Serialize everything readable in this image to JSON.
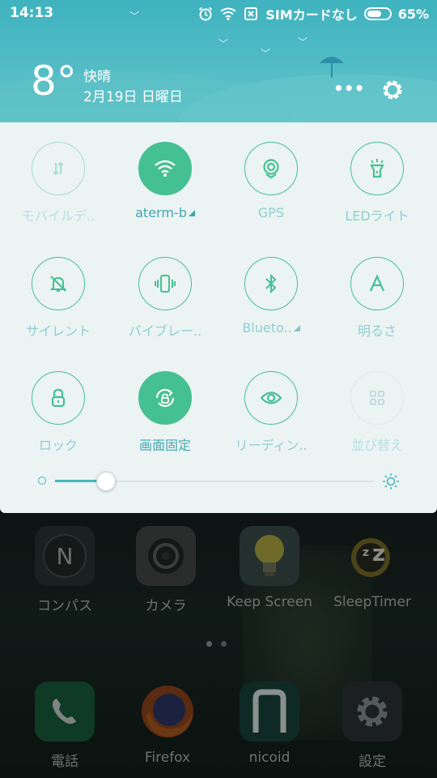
{
  "status_bar": {
    "time": "14:13",
    "carrier": "SIMカードなし",
    "battery_percent": "65%",
    "battery_level": 0.65,
    "icons": [
      "alarm-icon",
      "wifi-icon",
      "no-sim-icon",
      "battery-icon"
    ]
  },
  "weather": {
    "temperature": "8°",
    "condition": "快晴",
    "date": "2月19日 日曜日"
  },
  "header_actions": {
    "more": "•••",
    "settings_icon": "gear-icon"
  },
  "quick_tiles": [
    {
      "label": "モバイルデ..",
      "icon": "mobile-data-icon",
      "state": "off-disabled"
    },
    {
      "label": "aterm-b",
      "icon": "wifi-icon",
      "state": "on",
      "has_menu": true
    },
    {
      "label": "GPS",
      "icon": "gps-icon",
      "state": "off"
    },
    {
      "label": "LEDライト",
      "icon": "flashlight-icon",
      "state": "off"
    },
    {
      "label": "サイレント",
      "icon": "bell-off-icon",
      "state": "off"
    },
    {
      "label": "バイブレー..",
      "icon": "vibrate-icon",
      "state": "off"
    },
    {
      "label": "Blueto..",
      "icon": "bluetooth-icon",
      "state": "off",
      "has_menu": true
    },
    {
      "label": "明るさ",
      "icon": "auto-brightness-icon",
      "state": "off"
    },
    {
      "label": "ロック",
      "icon": "lock-icon",
      "state": "off"
    },
    {
      "label": "画面固定",
      "icon": "rotation-lock-icon",
      "state": "on"
    },
    {
      "label": "リーディン..",
      "icon": "eye-icon",
      "state": "off"
    },
    {
      "label": "並び替え",
      "icon": "grid-icon",
      "state": "off-disabled"
    }
  ],
  "brightness": {
    "level": 0.16
  },
  "home_apps": [
    {
      "label": "コンパス",
      "icon": "compass-icon"
    },
    {
      "label": "カメラ",
      "icon": "camera-icon"
    },
    {
      "label": "Keep Screen",
      "icon": "bulb-icon"
    },
    {
      "label": "SleepTimer",
      "icon": "sleep-timer-icon"
    }
  ],
  "dock_apps": [
    {
      "label": "電話",
      "icon": "phone-icon"
    },
    {
      "label": "Firefox",
      "icon": "firefox-icon"
    },
    {
      "label": "nicoid",
      "icon": "nicoid-icon"
    },
    {
      "label": "設定",
      "icon": "settings-icon"
    }
  ],
  "page_indicator": {
    "pages": 2,
    "current": 1
  },
  "colors": {
    "header": "#4bb8c2",
    "accent": "#45c093",
    "panel": "#ecf3f3",
    "label": "#8fcfd0"
  }
}
